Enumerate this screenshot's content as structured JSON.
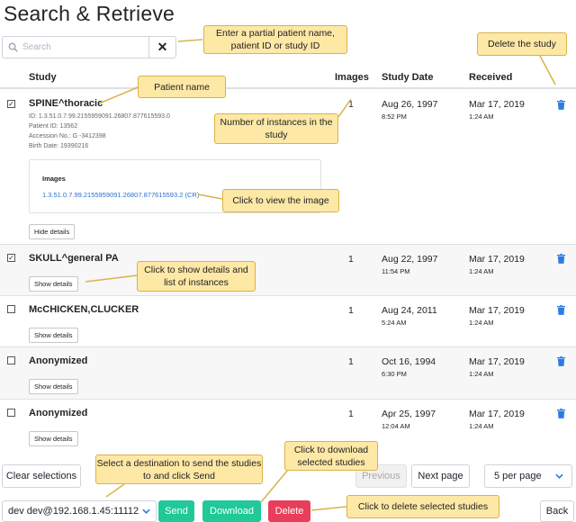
{
  "title": "Search & Retrieve",
  "search": {
    "placeholder": "Search",
    "clear_label": "✕"
  },
  "columns": {
    "study": "Study",
    "images": "Images",
    "study_date": "Study Date",
    "received": "Received"
  },
  "studies": [
    {
      "name": "SPINE^thoracic",
      "checked": true,
      "id_line": "ID: 1.3.51.0.7.99.2155959091.26807.877615593.0",
      "patient_line": "Patient ID: 13562",
      "accession_line": "Accession No.: G -3412398",
      "birth_line": "Birth Date: 19390216",
      "images": "1",
      "study_date": "Aug 26, 1997",
      "study_time": "8:52 PM",
      "received_date": "Mar 17, 2019",
      "received_time": "1:24 AM",
      "details_label": "Hide details",
      "images_title": "Images",
      "image_link": "1.3.51.0.7.99.2155959091.26807.877615593.2 (CR)"
    },
    {
      "name": "SKULL^general PA",
      "checked": true,
      "images": "1",
      "study_date": "Aug 22, 1997",
      "study_time": "11:54 PM",
      "received_date": "Mar 17, 2019",
      "received_time": "1:24 AM",
      "details_label": "Show details"
    },
    {
      "name": "McCHICKEN,CLUCKER",
      "checked": false,
      "images": "1",
      "study_date": "Aug 24, 2011",
      "study_time": "5:24 AM",
      "received_date": "Mar 17, 2019",
      "received_time": "1:24 AM",
      "details_label": "Show details"
    },
    {
      "name": "Anonymized",
      "checked": false,
      "images": "1",
      "study_date": "Oct 16, 1994",
      "study_time": "6:30 PM",
      "received_date": "Mar 17, 2019",
      "received_time": "1:24 AM",
      "details_label": "Show details"
    },
    {
      "name": "Anonymized",
      "checked": false,
      "images": "1",
      "study_date": "Apr 25, 1997",
      "study_time": "12:04 AM",
      "received_date": "Mar 17, 2019",
      "received_time": "1:24 AM",
      "details_label": "Show details"
    }
  ],
  "callouts": {
    "search": "Enter a partial patient name, patient ID or study ID",
    "delete_study": "Delete the study",
    "patient_name": "Patient name",
    "instances": "Number of instances in the study",
    "view_image": "Click to view the image",
    "show_details": "Click to show details and list of instances",
    "send": "Select a destination to send the studies to and click Send",
    "download": "Click to download selected studies",
    "delete_selected": "Click to delete selected studies"
  },
  "footer": {
    "clear_selections": "Clear selections",
    "previous": "Previous",
    "next": "Next page",
    "per_page": "5 per page",
    "destination": "dev dev@192.168.1.45:11112",
    "send": "Send",
    "download": "Download",
    "delete": "Delete",
    "back": "Back"
  },
  "colors": {
    "send": "#20c997",
    "download": "#20c997",
    "delete": "#e83e5b",
    "trash": "#2c7be5",
    "callout": "#fde8a6",
    "link": "#2c6fd1"
  }
}
